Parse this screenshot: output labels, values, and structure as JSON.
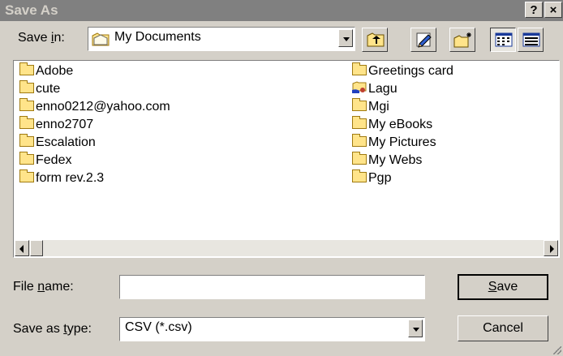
{
  "window": {
    "title": "Save As",
    "help_label": "?",
    "close_label": "×"
  },
  "save_in": {
    "label_pre": "Save ",
    "label_key": "i",
    "label_post": "n:",
    "value": "My Documents"
  },
  "toolbar": {
    "up_icon": "up-one-level-icon",
    "desktop_icon": "desktop-icon",
    "new_folder_icon": "create-new-folder-icon",
    "list_view_icon": "list-view-icon",
    "details_view_icon": "details-view-icon"
  },
  "files": {
    "column1": [
      "Adobe",
      "cute",
      "enno0212@yahoo.com",
      "enno2707",
      "Escalation",
      "Fedex",
      "form rev.2.3"
    ],
    "column2": [
      "Greetings card",
      "Lagu",
      "Mgi",
      "My eBooks",
      "My Pictures",
      "My Webs",
      "Pgp"
    ]
  },
  "file_name": {
    "label_pre": "File ",
    "label_key": "n",
    "label_post": "ame:",
    "value": ""
  },
  "save_as_type": {
    "label_pre": "Save as ",
    "label_key": "t",
    "label_post": "ype:",
    "value": "CSV (*.csv)"
  },
  "buttons": {
    "save_key": "S",
    "save_rest": "ave",
    "cancel": "Cancel"
  }
}
